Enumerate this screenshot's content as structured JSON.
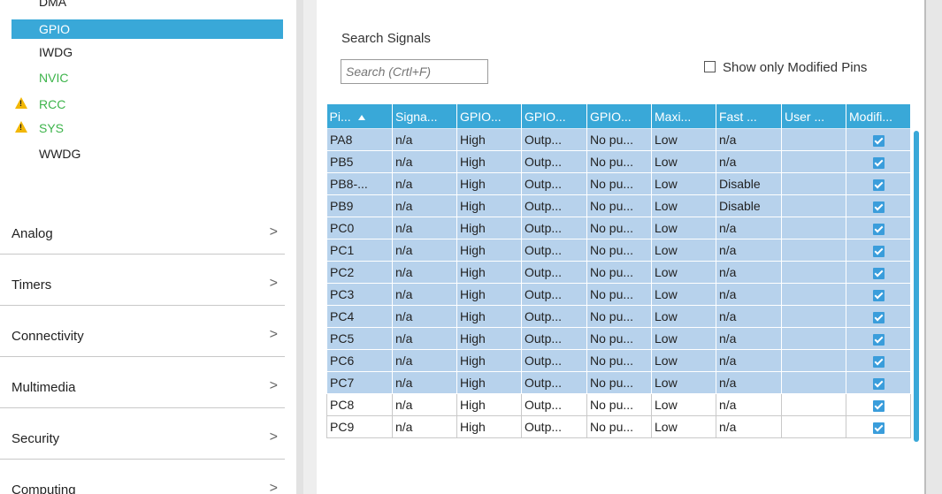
{
  "sidebar": {
    "system_items": [
      {
        "label": "DMA",
        "state": "normal",
        "warn": false
      },
      {
        "label": "GPIO",
        "state": "selected",
        "warn": false
      },
      {
        "label": "IWDG",
        "state": "normal",
        "warn": false
      },
      {
        "label": "NVIC",
        "state": "green",
        "warn": false
      },
      {
        "label": "RCC",
        "state": "green",
        "warn": true
      },
      {
        "label": "SYS",
        "state": "green",
        "warn": true
      },
      {
        "label": "WWDG",
        "state": "normal",
        "warn": false
      }
    ],
    "categories": [
      {
        "label": "Analog",
        "icon": "chevron-right-icon"
      },
      {
        "label": "Timers",
        "icon": "chevron-right-icon"
      },
      {
        "label": "Connectivity",
        "icon": "chevron-right-icon"
      },
      {
        "label": "Multimedia",
        "icon": "chevron-right-icon"
      },
      {
        "label": "Security",
        "icon": "chevron-right-icon"
      },
      {
        "label": "Computing",
        "icon": "chevron-right-icon"
      }
    ],
    "chevron": ">",
    "warn_glyph": "!"
  },
  "search": {
    "label": "Search Signals",
    "placeholder": "Search (Crtl+F)"
  },
  "filter": {
    "show_modified_label": "Show only Modified Pins",
    "checked": false
  },
  "table": {
    "columns": [
      "Pi...",
      "Signa...",
      "GPIO...",
      "GPIO...",
      "GPIO...",
      "Maxi...",
      "Fast ...",
      "User ...",
      "Modifi..."
    ],
    "sorted_column": 0,
    "rows": [
      {
        "cells": [
          "PA8",
          "n/a",
          "High",
          "Outp...",
          "No pu...",
          "Low",
          "n/a",
          "",
          true
        ],
        "selected": true
      },
      {
        "cells": [
          "PB5",
          "n/a",
          "High",
          "Outp...",
          "No pu...",
          "Low",
          "n/a",
          "",
          true
        ],
        "selected": true
      },
      {
        "cells": [
          "PB8-...",
          "n/a",
          "High",
          "Outp...",
          "No pu...",
          "Low",
          "Disable",
          "",
          true
        ],
        "selected": true
      },
      {
        "cells": [
          "PB9",
          "n/a",
          "High",
          "Outp...",
          "No pu...",
          "Low",
          "Disable",
          "",
          true
        ],
        "selected": true
      },
      {
        "cells": [
          "PC0",
          "n/a",
          "High",
          "Outp...",
          "No pu...",
          "Low",
          "n/a",
          "",
          true
        ],
        "selected": true
      },
      {
        "cells": [
          "PC1",
          "n/a",
          "High",
          "Outp...",
          "No pu...",
          "Low",
          "n/a",
          "",
          true
        ],
        "selected": true
      },
      {
        "cells": [
          "PC2",
          "n/a",
          "High",
          "Outp...",
          "No pu...",
          "Low",
          "n/a",
          "",
          true
        ],
        "selected": true
      },
      {
        "cells": [
          "PC3",
          "n/a",
          "High",
          "Outp...",
          "No pu...",
          "Low",
          "n/a",
          "",
          true
        ],
        "selected": true
      },
      {
        "cells": [
          "PC4",
          "n/a",
          "High",
          "Outp...",
          "No pu...",
          "Low",
          "n/a",
          "",
          true
        ],
        "selected": true
      },
      {
        "cells": [
          "PC5",
          "n/a",
          "High",
          "Outp...",
          "No pu...",
          "Low",
          "n/a",
          "",
          true
        ],
        "selected": true
      },
      {
        "cells": [
          "PC6",
          "n/a",
          "High",
          "Outp...",
          "No pu...",
          "Low",
          "n/a",
          "",
          true
        ],
        "selected": true
      },
      {
        "cells": [
          "PC7",
          "n/a",
          "High",
          "Outp...",
          "No pu...",
          "Low",
          "n/a",
          "",
          true
        ],
        "selected": true
      },
      {
        "cells": [
          "PC8",
          "n/a",
          "High",
          "Outp...",
          "No pu...",
          "Low",
          "n/a",
          "",
          true
        ],
        "selected": false
      },
      {
        "cells": [
          "PC9",
          "n/a",
          "High",
          "Outp...",
          "No pu...",
          "Low",
          "n/a",
          "",
          true
        ],
        "selected": false
      }
    ]
  },
  "colors": {
    "accent": "#39a8d8",
    "selected_row": "#b7d2ec",
    "green_text": "#3db44b",
    "warning": "#f2b705",
    "checkbox": "#3a9ddb"
  }
}
